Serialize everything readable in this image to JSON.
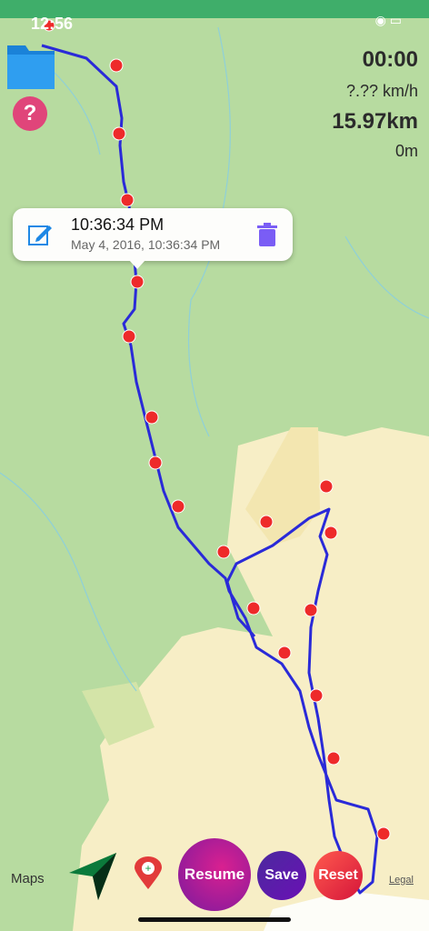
{
  "status_bar": {
    "time": "12:56"
  },
  "stats": {
    "elapsed": "00:00",
    "speed": "?.?? km/h",
    "distance": "15.97km",
    "altitude": "0m"
  },
  "callout": {
    "title": "10:36:34 PM",
    "subtitle": "May 4, 2016, 10:36:34 PM"
  },
  "buttons": {
    "resume": "Resume",
    "save": "Save",
    "reset": "Reset",
    "help": "?"
  },
  "map": {
    "attribution": "Maps",
    "legal": "Legal",
    "route_color": "#2a2ad8",
    "pin_color": "#ee2a2a"
  },
  "icons": [
    "folder-icon",
    "help-icon",
    "edit-icon",
    "trash-icon",
    "compass-arrow-icon",
    "add-pin-icon",
    "apple-icon",
    "wifi-icon",
    "battery-icon",
    "location-arrow-icon"
  ]
}
